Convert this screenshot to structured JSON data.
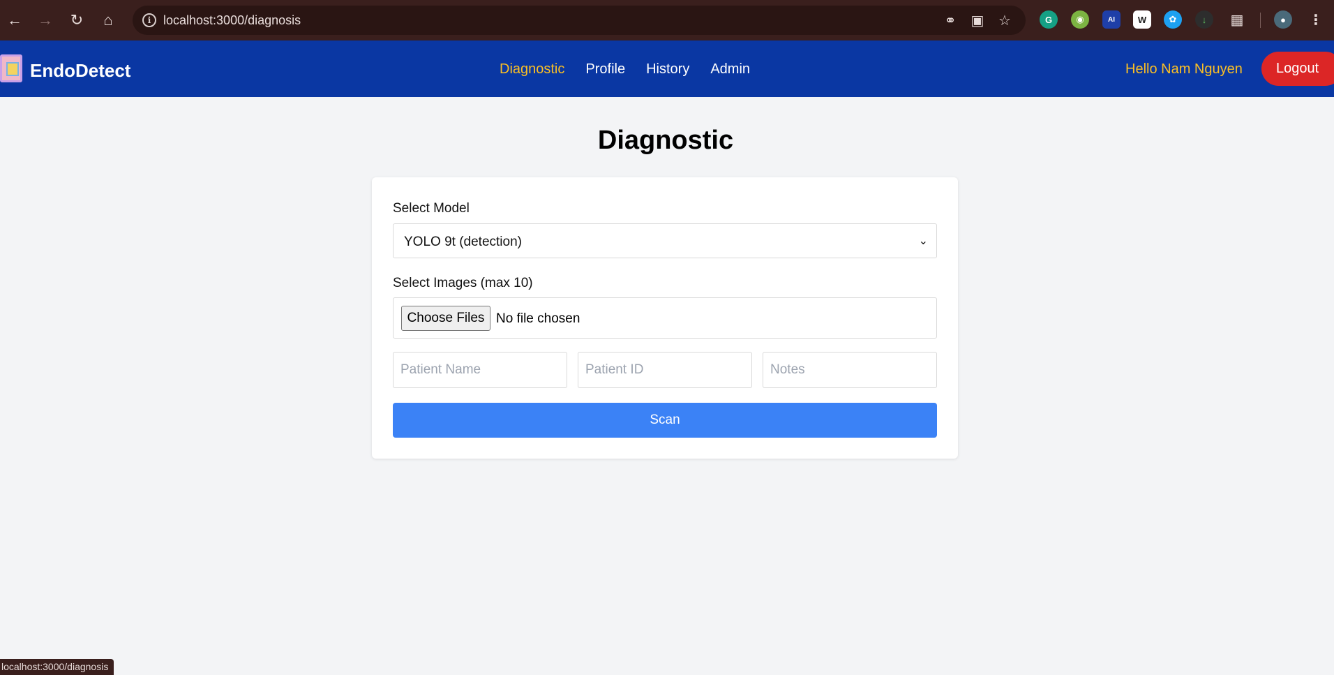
{
  "browser": {
    "url": "localhost:3000/diagnosis",
    "status_url": "localhost:3000/diagnosis",
    "icons": [
      "back-icon",
      "forward-icon",
      "reload-icon",
      "home-icon",
      "site-info-icon",
      "password-key-icon",
      "install-app-icon",
      "bookmark-star-icon",
      "extensions-puzzle-icon",
      "profile-avatar-icon",
      "more-menu-icon"
    ],
    "extension_labels": [
      "G",
      "AI",
      "W"
    ]
  },
  "header": {
    "brand": "EndoDetect",
    "nav": [
      {
        "label": "Diagnostic",
        "active": true
      },
      {
        "label": "Profile",
        "active": false
      },
      {
        "label": "History",
        "active": false
      },
      {
        "label": "Admin",
        "active": false
      }
    ],
    "greeting": "Hello Nam Nguyen",
    "logout_label": "Logout"
  },
  "main": {
    "title": "Diagnostic",
    "model_label": "Select Model",
    "model_selected": "YOLO 9t (detection)",
    "images_label": "Select Images (max 10)",
    "choose_files_label": "Choose Files",
    "file_status": "No file chosen",
    "patient_name_placeholder": "Patient Name",
    "patient_id_placeholder": "Patient ID",
    "notes_placeholder": "Notes",
    "scan_label": "Scan"
  },
  "colors": {
    "header_bg": "#0a37a3",
    "accent_yellow": "#fbbf24",
    "logout_red": "#dc2626",
    "scan_blue": "#3b82f6",
    "page_bg": "#f3f4f6",
    "chrome_bg": "#3a1f1d"
  }
}
